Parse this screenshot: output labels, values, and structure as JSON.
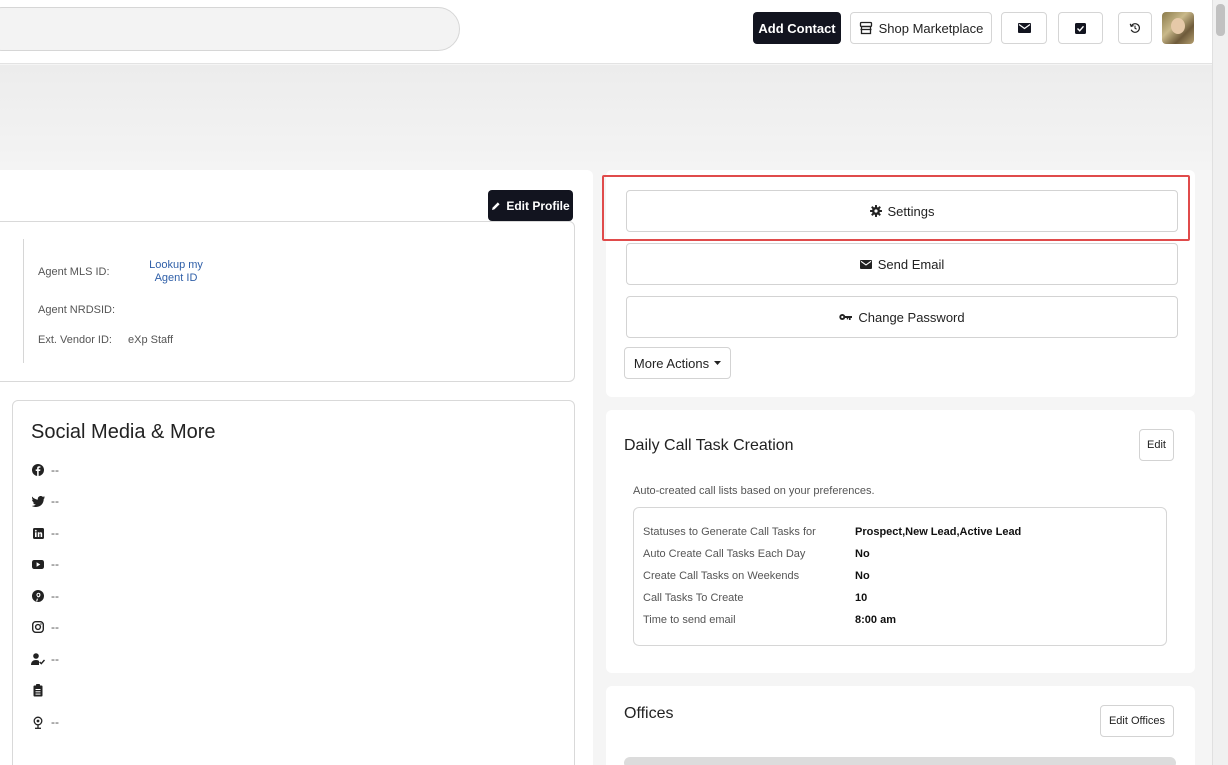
{
  "header": {
    "add_contact_label": "Add Contact",
    "shop_label": "Shop Marketplace"
  },
  "profile": {
    "edit_label": "Edit Profile",
    "fields": {
      "mls_label": "Agent MLS ID:",
      "lookup_link": "Lookup my Agent ID",
      "nrdsid_label": "Agent NRDSID:",
      "vendor_label": "Ext. Vendor ID:",
      "vendor_value": "eXp Staff"
    }
  },
  "social": {
    "title": "Social Media & More",
    "items": [
      {
        "icon": "facebook-icon",
        "value": "--"
      },
      {
        "icon": "twitter-icon",
        "value": "--"
      },
      {
        "icon": "linkedin-icon",
        "value": "--"
      },
      {
        "icon": "youtube-icon",
        "value": "--"
      },
      {
        "icon": "pinterest-icon",
        "value": "--"
      },
      {
        "icon": "instagram-icon",
        "value": "--"
      },
      {
        "icon": "user-check-icon",
        "value": "--"
      },
      {
        "icon": "badge-icon",
        "value": ""
      },
      {
        "icon": "globe-icon",
        "value": "--"
      }
    ]
  },
  "actions": {
    "settings_label": "Settings",
    "send_email_label": "Send Email",
    "change_password_label": "Change Password",
    "more_actions_label": "More Actions"
  },
  "call_tasks": {
    "title": "Daily Call Task Creation",
    "edit_label": "Edit",
    "description": "Auto-created call lists based on your preferences.",
    "rows": [
      {
        "label": "Statuses to Generate Call Tasks for",
        "value": "Prospect,New Lead,Active Lead"
      },
      {
        "label": "Auto Create Call Tasks Each Day",
        "value": "No"
      },
      {
        "label": "Create Call Tasks on Weekends",
        "value": "No"
      },
      {
        "label": "Call Tasks To Create",
        "value": "10"
      },
      {
        "label": "Time to send email",
        "value": "8:00 am"
      }
    ]
  },
  "offices": {
    "title": "Offices",
    "edit_label": "Edit Offices"
  },
  "colors": {
    "dark_button": "#12141f",
    "highlight": "#e04b4b",
    "link": "#2f5fa8"
  }
}
